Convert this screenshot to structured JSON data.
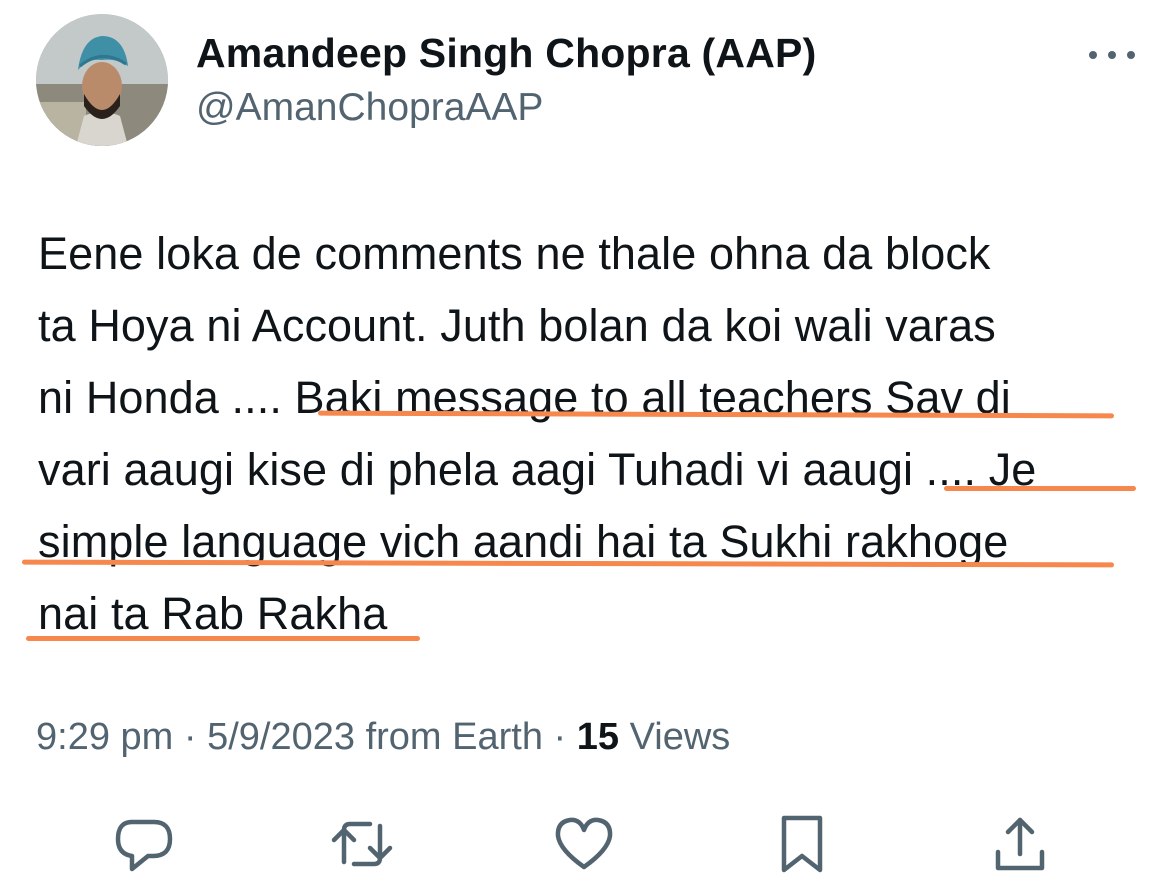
{
  "author": {
    "display_name": "Amandeep Singh Chopra (AAP)",
    "handle": "@AmanChopraAAP",
    "avatar_icon": "profile-photo"
  },
  "more_icon": "ellipsis-icon",
  "tweet": {
    "lines": [
      "Eene loka de comments ne thale ohna da block",
      "ta Hoya ni Account. Juth bolan da koi wali varas",
      "ni Honda .... Baki message to all teachers Sav di",
      "vari aaugi kise di phela aagi Tuhadi vi aaugi .... Je",
      "simple language vich aandi hai ta Sukhi rakhoge",
      "nai ta Rab Rakha"
    ],
    "highlight_color": "#f6874d"
  },
  "meta": {
    "time": "9:29 pm",
    "separator": " · ",
    "date": "5/9/2023",
    "source": " from Earth",
    "separator2": " · ",
    "views_count": "15",
    "views_label": " Views"
  },
  "actions": [
    {
      "icon": "reply-icon"
    },
    {
      "icon": "retweet-icon"
    },
    {
      "icon": "like-icon"
    },
    {
      "icon": "bookmark-icon"
    },
    {
      "icon": "share-icon"
    }
  ],
  "colors": {
    "text": "#0f1419",
    "secondary": "#536471",
    "underline": "#f6874d"
  }
}
